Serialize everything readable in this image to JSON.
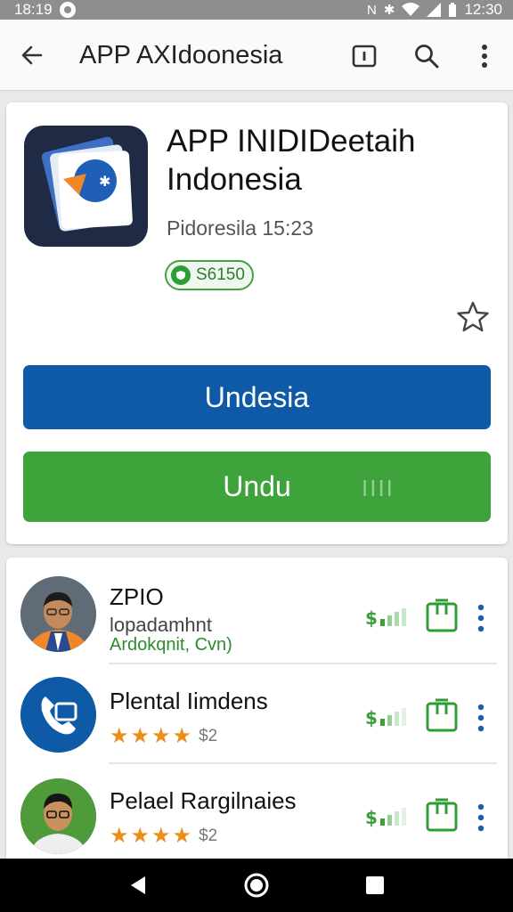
{
  "status_bar": {
    "time_left": "18:19",
    "time_right": "12:30",
    "icons": [
      "notification-icon",
      "nfc-icon",
      "bluetooth-icon",
      "wifi-icon",
      "signal-icon",
      "battery-icon"
    ]
  },
  "app_bar": {
    "title": "APP AXIdoonesia",
    "icons": [
      "back-arrow-icon",
      "info-icon",
      "search-icon",
      "more-vert-icon"
    ]
  },
  "detail": {
    "title": "APP INIDIDeetaih Indonesia",
    "subtitle": "Pidoresila 15:23",
    "badge": "S6150",
    "primary_button": "Undesia",
    "secondary_button": "Undu",
    "secondary_button_faint": "IIII"
  },
  "list": {
    "items": [
      {
        "name": "ZPIO",
        "line2": "lopadamhnt",
        "line3": "Ardokqnit, Cvn)",
        "avatar": "person-avatar"
      },
      {
        "name": "Plental Iimdens",
        "rating_stars": 4,
        "rating_count": "$2",
        "avatar": "phone-icon"
      },
      {
        "name": "Pelael Rargilnaies",
        "rating_stars": 4,
        "rating_count": "$2",
        "avatar": "person-avatar"
      }
    ]
  },
  "colors": {
    "primary_blue": "#0e5aa7",
    "primary_green": "#3da33a",
    "star_orange": "#ef8c1a",
    "status_bar": "#8e8e8e"
  }
}
